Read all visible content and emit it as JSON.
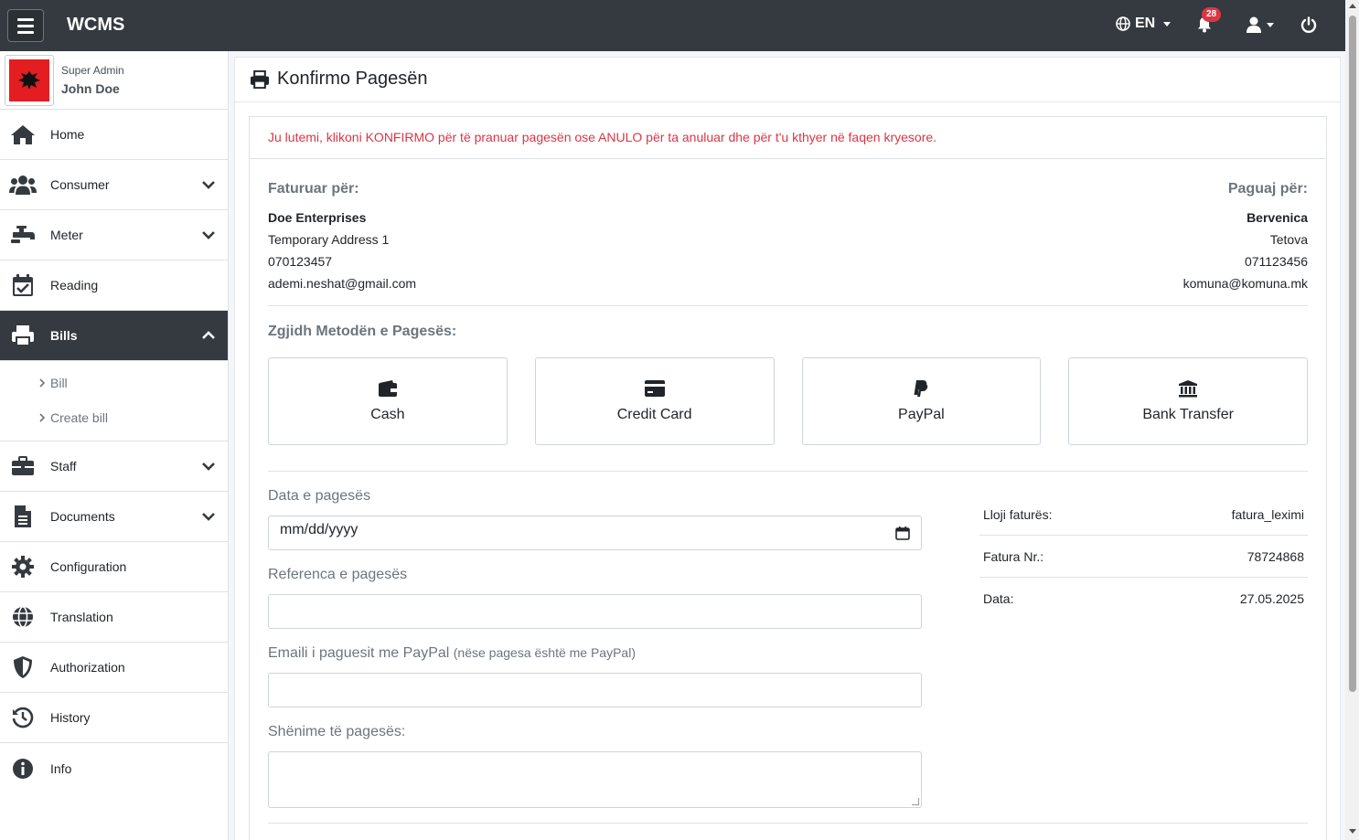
{
  "app": {
    "brand": "WCMS",
    "language": "EN",
    "notification_count": "28"
  },
  "user": {
    "role": "Super Admin",
    "name": "John Doe"
  },
  "sidebar": {
    "items": [
      {
        "label": "Home"
      },
      {
        "label": "Consumer"
      },
      {
        "label": "Meter"
      },
      {
        "label": "Reading"
      },
      {
        "label": "Bills"
      },
      {
        "label": "Staff"
      },
      {
        "label": "Documents"
      },
      {
        "label": "Configuration"
      },
      {
        "label": "Translation"
      },
      {
        "label": "Authorization"
      },
      {
        "label": "History"
      },
      {
        "label": "Info"
      }
    ],
    "bills_sub": [
      {
        "label": "Bill"
      },
      {
        "label": "Create bill"
      }
    ]
  },
  "page": {
    "title": "Konfirmo Pagesën",
    "alert": "Ju lutemi, klikoni KONFIRMO për të pranuar pagesën ose ANULO për ta anuluar dhe për t'u kthyer në faqen kryesore.",
    "billed_to": {
      "heading": "Faturuar për:",
      "name": "Doe Enterprises",
      "address": "Temporary Address 1",
      "phone": "070123457",
      "email": "ademi.neshat@gmail.com"
    },
    "pay_to": {
      "heading": "Paguaj për:",
      "name": "Bervenica",
      "city": "Tetova",
      "phone": "071123456",
      "email": "komuna@komuna.mk"
    },
    "method_heading": "Zgjidh Metodën e Pagesës:",
    "methods": [
      {
        "label": "Cash"
      },
      {
        "label": "Credit Card"
      },
      {
        "label": "PayPal"
      },
      {
        "label": "Bank Transfer"
      }
    ],
    "form": {
      "date_label": "Data e pagesës",
      "date_placeholder": "mm/dd/yyyy",
      "reference_label": "Referenca e pagesës",
      "paypal_label": "Emaili i paguesit me PayPal",
      "paypal_hint": "(nëse pagesa është me PayPal)",
      "notes_label": "Shënime të pagesës:"
    },
    "info": {
      "type_label": "Lloji faturës:",
      "type_value": "fatura_leximi",
      "number_label": "Fatura Nr.:",
      "number_value": "78724868",
      "date_label": "Data:",
      "date_value": "27.05.2025"
    }
  }
}
